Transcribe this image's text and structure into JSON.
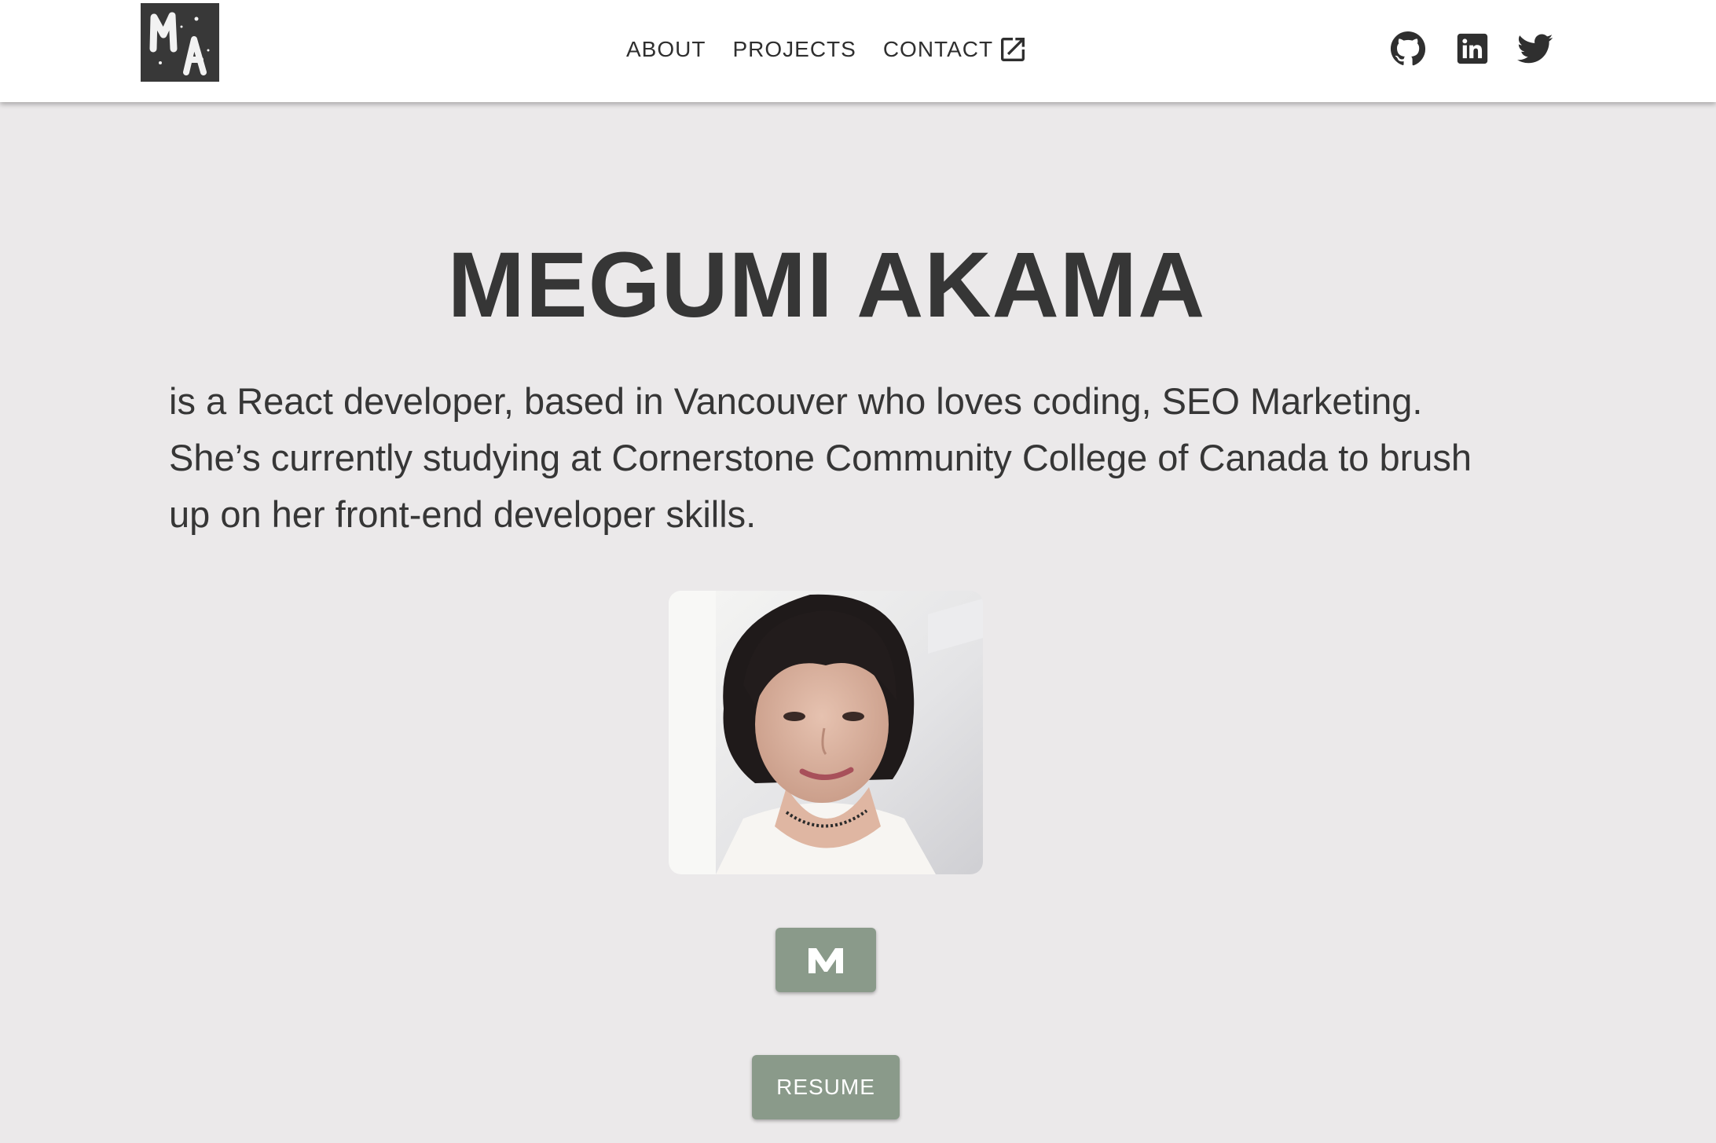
{
  "header": {
    "logo_text": "MA",
    "nav": [
      {
        "label": "ABOUT"
      },
      {
        "label": "PROJECTS"
      },
      {
        "label": "CONTACT",
        "icon": "external-link-icon"
      }
    ],
    "social_icons": [
      "github-icon",
      "linkedin-icon",
      "twitter-icon"
    ]
  },
  "hero": {
    "name": "MEGUMI AKAMA",
    "intro": "is a React developer, based in Vancouver who loves coding, SEO Marketing. She’s currently studying at Cornerstone Community College of Canada to brush up on her front-end developer skills.",
    "medium_icon": "medium-icon",
    "resume_label": "RESUME"
  },
  "colors": {
    "background": "#ebe9ea",
    "text": "#363636",
    "button": "#8a9a8a",
    "logo_bg": "#383838"
  }
}
